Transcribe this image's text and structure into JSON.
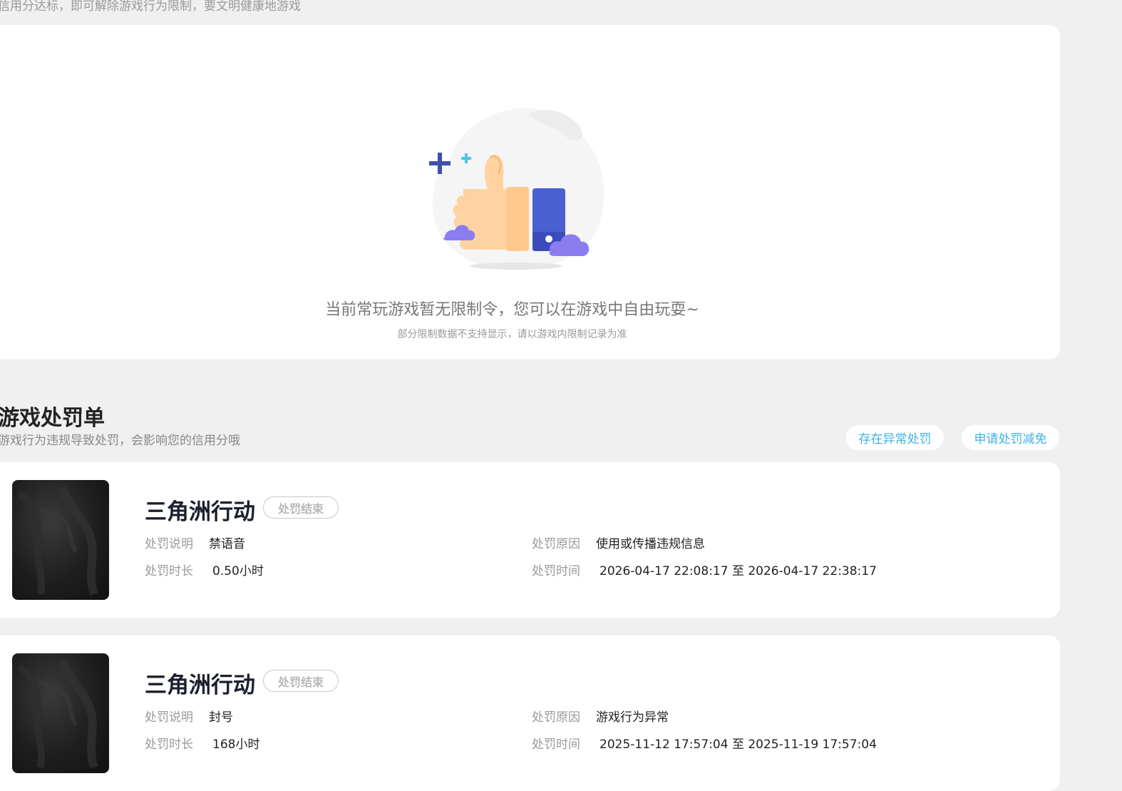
{
  "top_note": "信用分达标，即可解除游戏行为限制，要文明健康地游戏",
  "empty_state": {
    "illustration_icon": "thumbs-up-icon",
    "title": "当前常玩游戏暂无限制令，您可以在游戏中自由玩耍~",
    "subtitle": "部分限制数据不支持显示，请以游戏内限制记录为准"
  },
  "section": {
    "title": "游戏处罚单",
    "subtitle": "游戏行为违规导致处罚，会影响您的信用分哦",
    "btn_abnormal": "存在异常处罚",
    "btn_appeal": "申请处罚减免"
  },
  "labels": {
    "desc": "处罚说明",
    "reason": "处罚原因",
    "duration": "处罚时长",
    "time": "处罚时间"
  },
  "colors": {
    "accent": "#3cb3e6",
    "thumb_blue": "#4a5fd0",
    "cloud_purple": "#8b7cf0"
  },
  "penalties": [
    {
      "game": "三角洲行动",
      "status": "处罚结束",
      "desc": "禁语音",
      "reason": "使用或传播违规信息",
      "duration": "0.50小时",
      "time": "2026-04-17 22:08:17 至 2026-04-17 22:38:17"
    },
    {
      "game": "三角洲行动",
      "status": "处罚结束",
      "desc": "封号",
      "reason": "游戏行为异常",
      "duration": "168小时",
      "time": "2025-11-12 17:57:04 至 2025-11-19 17:57:04"
    }
  ]
}
